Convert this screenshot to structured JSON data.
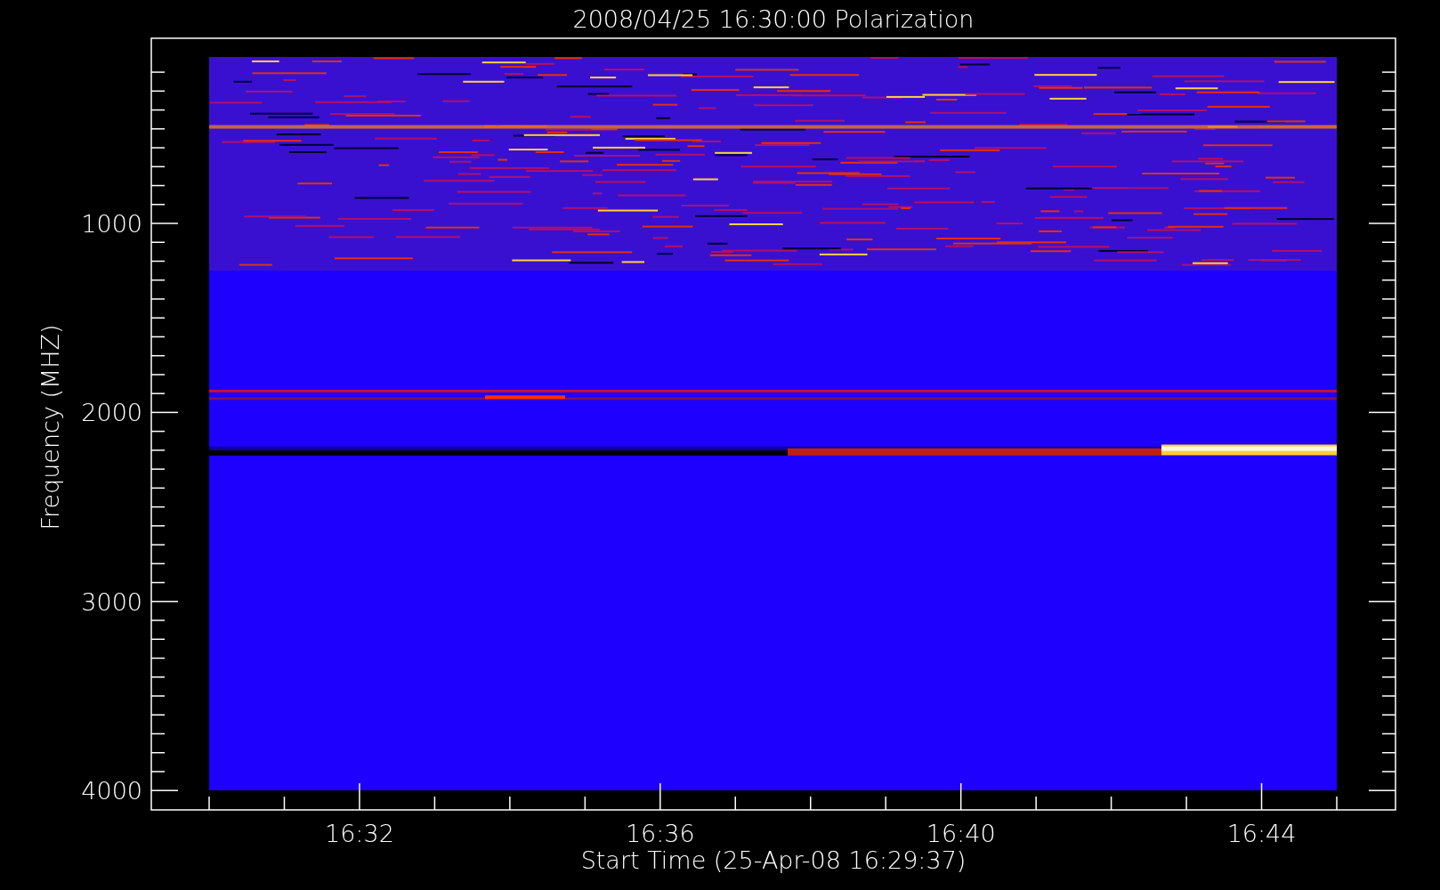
{
  "title": "2008/04/25 16:30:00 Polarization",
  "ylabel": "Frequency (MHZ)",
  "xlabel": "Start Time (25-Apr-08 16:29:37)",
  "y_ticks": [
    "1000",
    "2000",
    "3000",
    "4000"
  ],
  "x_ticks": [
    "16:32",
    "16:36",
    "16:40",
    "16:44"
  ]
}
